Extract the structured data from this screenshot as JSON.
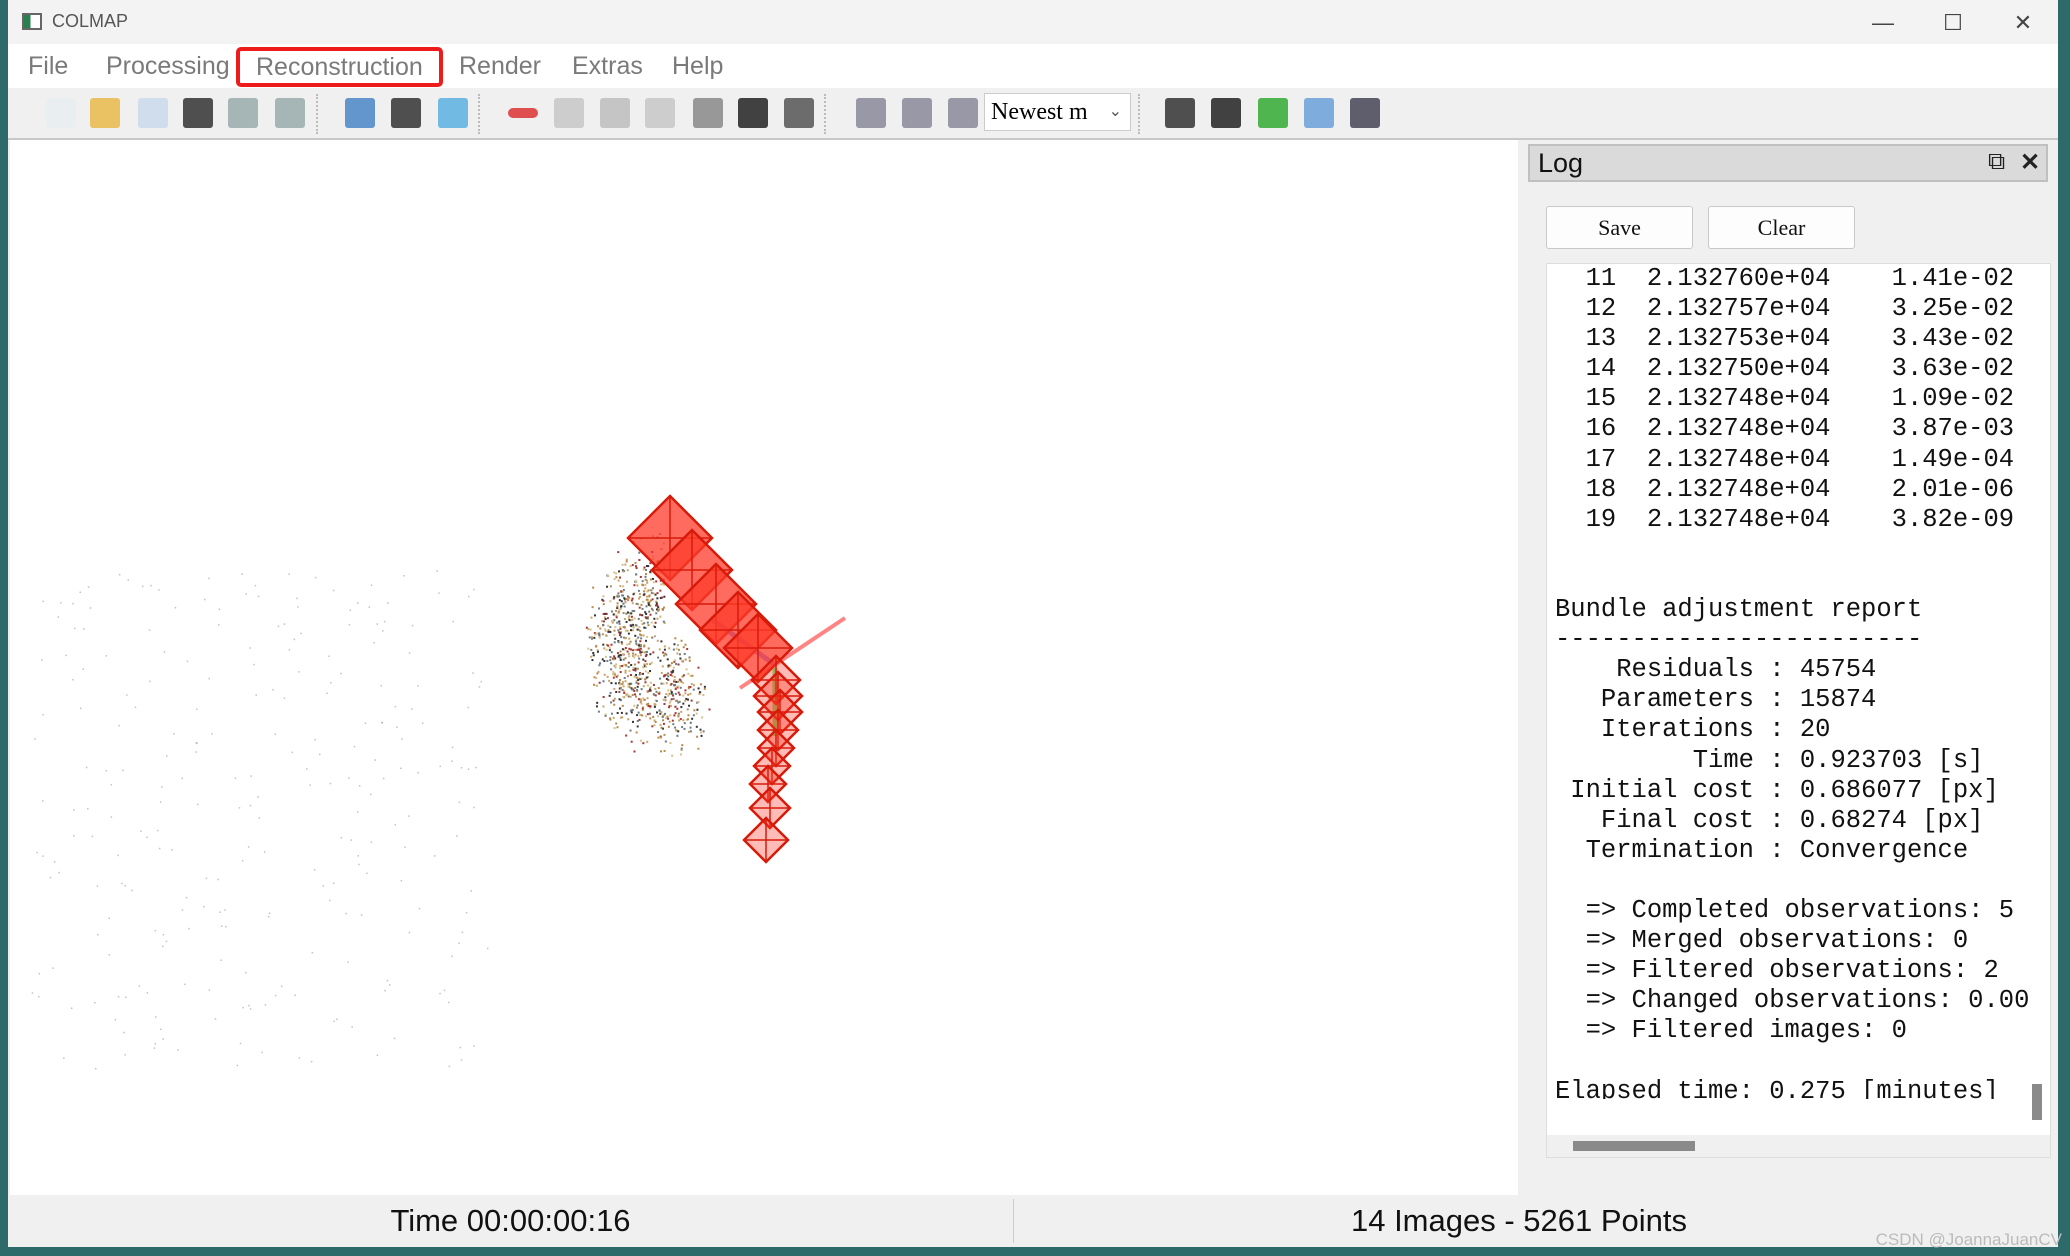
{
  "window": {
    "title": "COLMAP",
    "controls": [
      "—",
      "☐",
      "✕"
    ]
  },
  "menu": [
    "File",
    "Processing",
    "Reconstruction",
    "Render",
    "Extras",
    "Help"
  ],
  "menu_highlighted": "Reconstruction",
  "highlight_color": "#ee1b1b",
  "toolbar": {
    "icons": [
      "new-project-icon",
      "open-project-icon",
      "edit-project-icon",
      "save-project-icon",
      "import-model-icon",
      "export-model-icon",
      "feature-extraction-icon",
      "feature-matching-icon",
      "database-management-icon",
      "reconstruction-options-icon",
      "start-reconstruction-icon",
      "step-reconstruction-icon",
      "pause-reconstruction-icon",
      "reconstruction-reset-icon",
      "bundle-adjustment-icon",
      "dense-reconstruction-icon",
      "add-images-icon",
      "export-images-icon",
      "network-icon",
      "log-icon",
      "match-matrix-icon",
      "reconstruction-stats-icon",
      "grab-image-icon",
      "grab-movie-icon"
    ],
    "combo_value": "Newest m"
  },
  "log": {
    "title": "Log",
    "save_label": "Save",
    "clear_label": "Clear",
    "lines": [
      "  11  2.132760e+04    1.41e-02",
      "  12  2.132757e+04    3.25e-02",
      "  13  2.132753e+04    3.43e-02",
      "  14  2.132750e+04    3.63e-02",
      "  15  2.132748e+04    1.09e-02",
      "  16  2.132748e+04    3.87e-03",
      "  17  2.132748e+04    1.49e-04",
      "  18  2.132748e+04    2.01e-06",
      "  19  2.132748e+04    3.82e-09",
      "",
      "",
      "Bundle adjustment report",
      "------------------------",
      "    Residuals : 45754",
      "   Parameters : 15874",
      "   Iterations : 20",
      "         Time : 0.923703 [s]",
      " Initial cost : 0.686077 [px]",
      "   Final cost : 0.68274 [px]",
      "  Termination : Convergence",
      "",
      "  => Completed observations: 5",
      "  => Merged observations: 0",
      "  => Filtered observations: 2",
      "  => Changed observations: 0.00",
      "  => Filtered images: 0",
      "",
      "Elapsed time: 0.275 [minutes]"
    ]
  },
  "status": {
    "time": "Time 00:00:00:16",
    "summary": "14 Images - 5261 Points"
  },
  "watermark": "CSDN @JoannaJuanCV",
  "colors": {
    "camera": "#ff3b2a",
    "camera_edge": "#d81a0a"
  }
}
